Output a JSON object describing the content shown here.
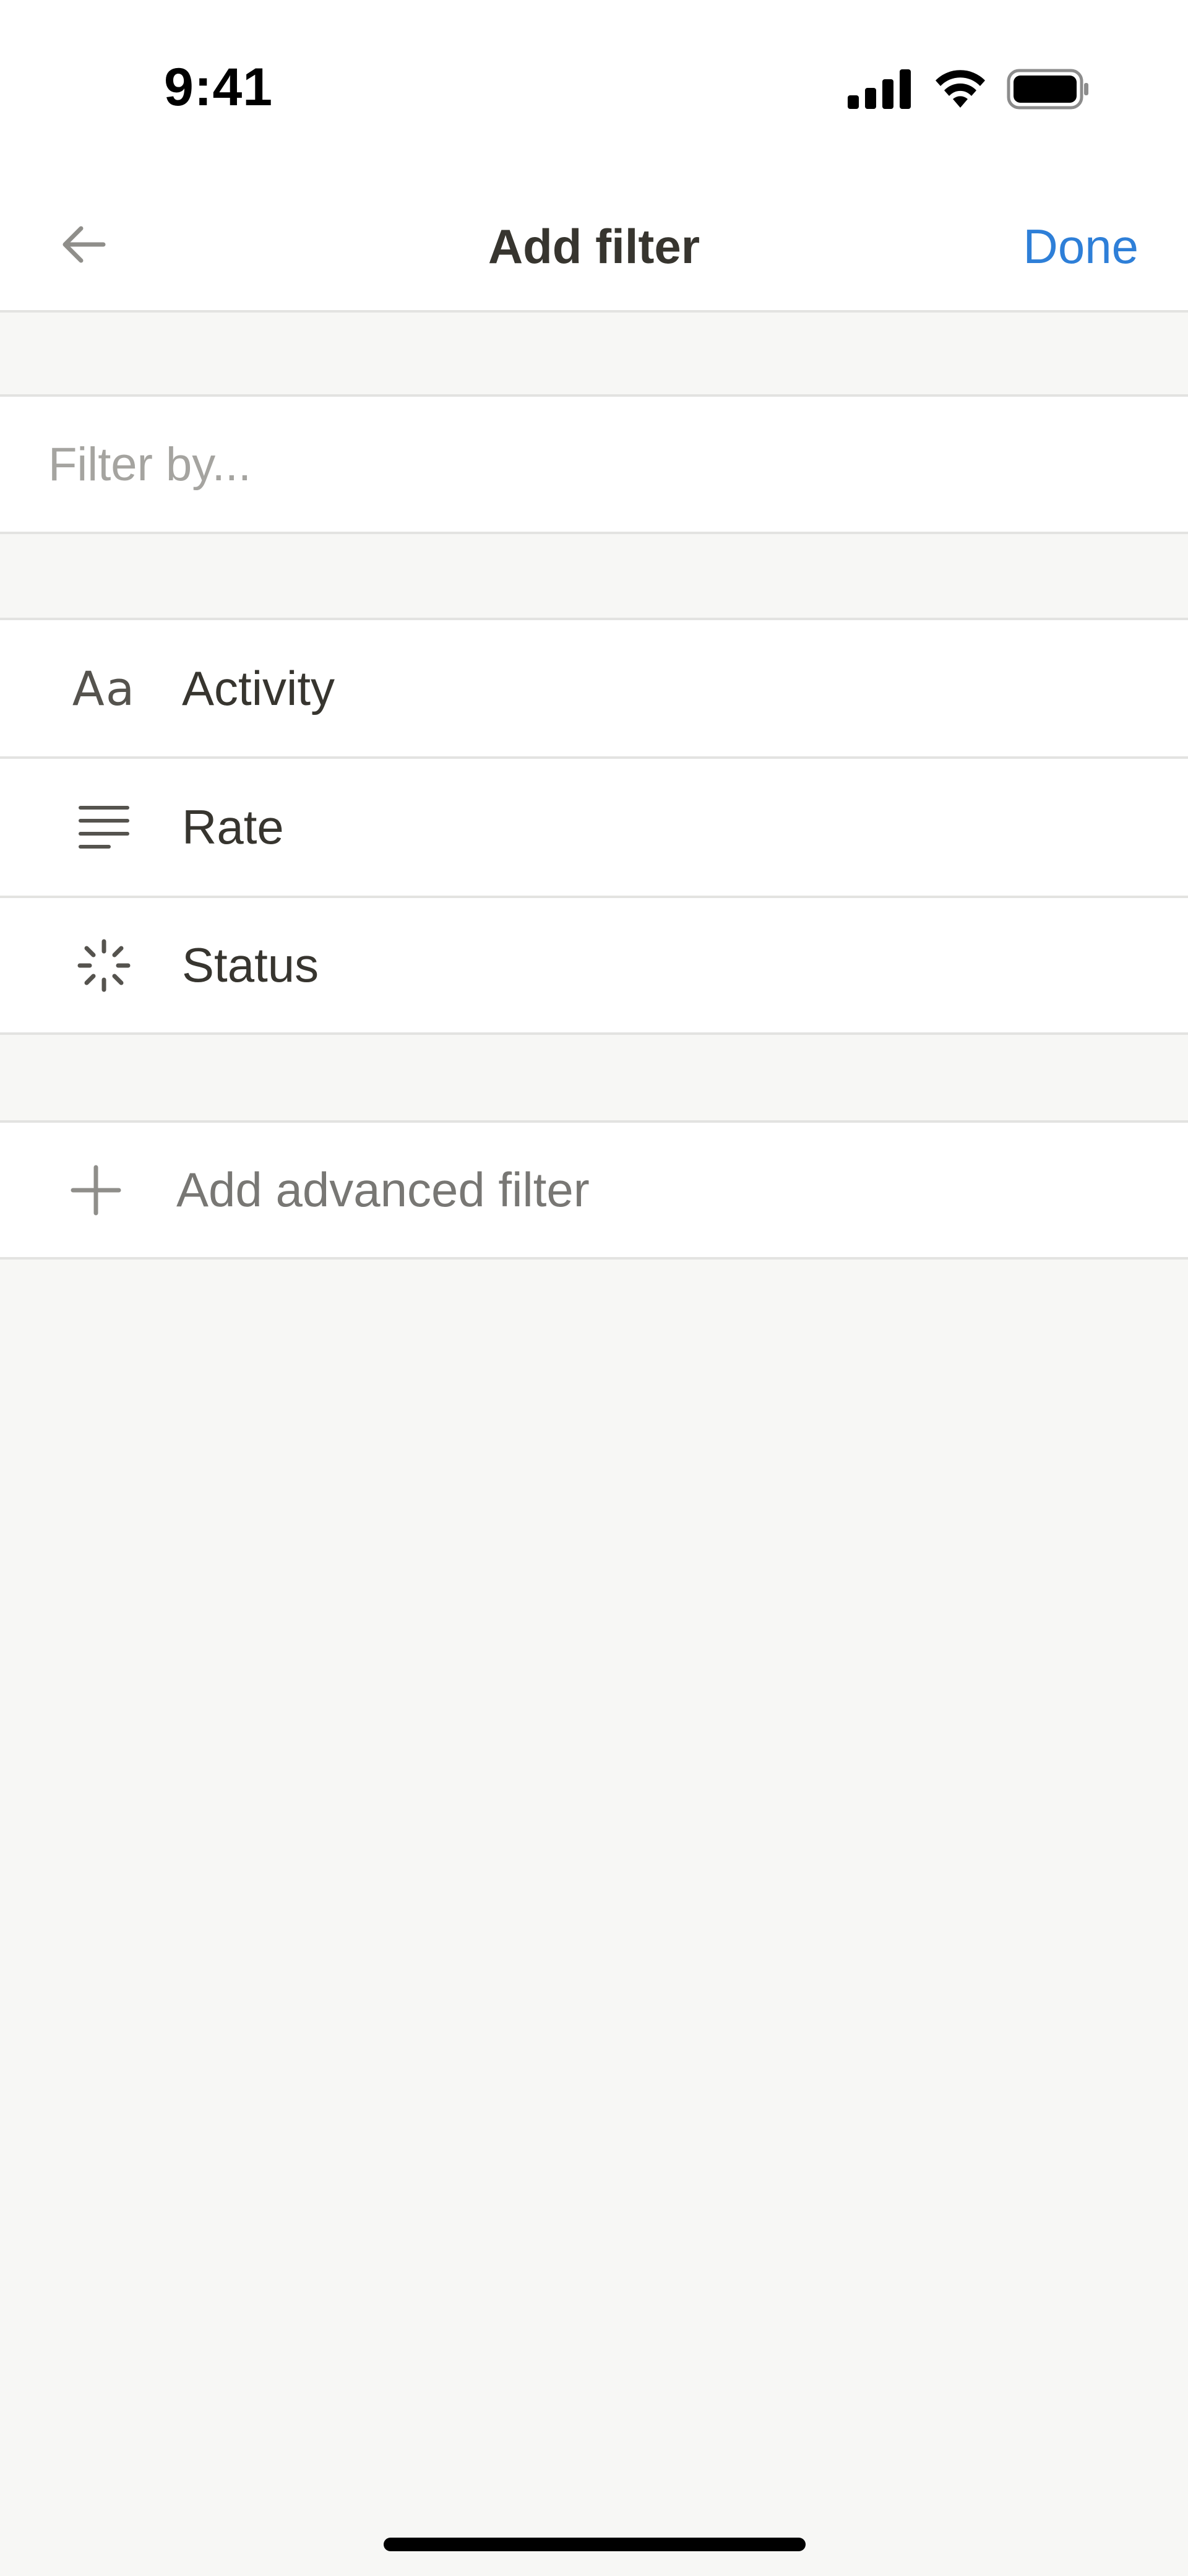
{
  "status_bar": {
    "time": "9:41",
    "icons": [
      "cellular-signal-icon",
      "wifi-icon",
      "battery-icon"
    ]
  },
  "nav": {
    "title": "Add filter",
    "done_label": "Done",
    "back_icon": "arrow-left-icon"
  },
  "search": {
    "placeholder": "Filter by...",
    "value": ""
  },
  "properties": [
    {
      "label": "Activity",
      "icon": "text-aa-icon"
    },
    {
      "label": "Rate",
      "icon": "text-lines-icon"
    },
    {
      "label": "Status",
      "icon": "status-spinner-icon"
    }
  ],
  "advanced": {
    "label": "Add advanced filter",
    "icon": "plus-icon"
  },
  "colors": {
    "accent": "#2e7fd8",
    "text": "#37352f",
    "muted": "#787774",
    "placeholder": "#a5a4a0",
    "background": "#f7f7f5",
    "divider": "#e3e3e1"
  }
}
